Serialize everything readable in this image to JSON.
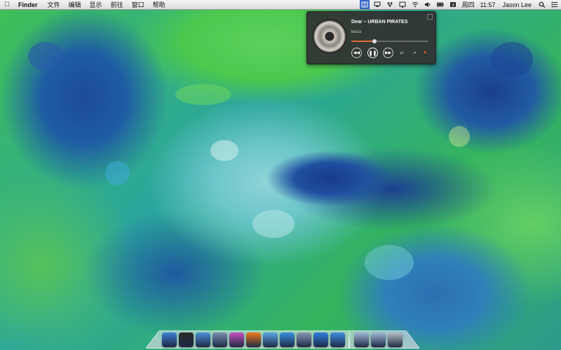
{
  "menubar": {
    "app_name": "Finder",
    "menus": [
      "文件",
      "编辑",
      "显示",
      "前往",
      "窗口",
      "帮助"
    ],
    "status_icons": [
      "translate-icon",
      "airplay-icon",
      "dropbox-icon",
      "display-icon",
      "wifi-icon",
      "volume-icon",
      "battery-icon",
      "duoshuo-icon"
    ],
    "day": "周四",
    "time": "11:57",
    "user": "Jason Lee"
  },
  "player": {
    "title": "Dear – URBAN PIRATES",
    "artist": "lecca",
    "progress": 0.3,
    "accent": "#e06b3a"
  },
  "dock": {
    "apps": [
      {
        "name": "finder-icon",
        "color": "#3f7fd4"
      },
      {
        "name": "terminal-icon",
        "color": "#2b2b2b"
      },
      {
        "name": "safari-icon",
        "color": "#4c8fd8"
      },
      {
        "name": "xcode-tools-icon",
        "color": "#7a8db0"
      },
      {
        "name": "flower-app-icon",
        "color": "#c94fc0"
      },
      {
        "name": "xiami-icon",
        "color": "#f07a1c"
      },
      {
        "name": "messages-icon",
        "color": "#59a7e8"
      },
      {
        "name": "qq-icon",
        "color": "#3a8fe0"
      },
      {
        "name": "preview-icon",
        "color": "#8a97b4"
      },
      {
        "name": "app-store-icon",
        "color": "#2f7de0"
      },
      {
        "name": "itunes-icon",
        "color": "#3d8de5"
      }
    ],
    "stacks": [
      {
        "name": "applications-folder-icon",
        "color": "#9fb9d6"
      },
      {
        "name": "downloads-folder-icon",
        "color": "#9fb9d6"
      },
      {
        "name": "trash-icon",
        "color": "#b9bfc6"
      }
    ]
  }
}
